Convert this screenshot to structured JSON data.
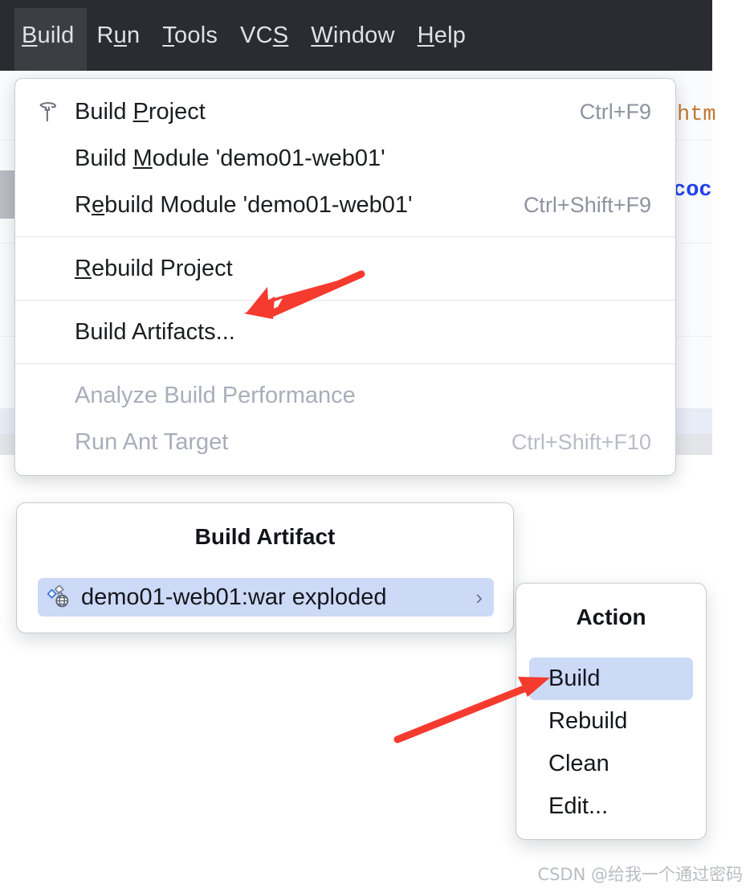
{
  "menubar": {
    "items": [
      {
        "label": "Build",
        "mnemonic": "B",
        "active": true
      },
      {
        "label": "Run",
        "mnemonic": "u",
        "active": false
      },
      {
        "label": "Tools",
        "mnemonic": "T",
        "active": false
      },
      {
        "label": "VCS",
        "mnemonic": "S",
        "active": false
      },
      {
        "label": "Window",
        "mnemonic": "W",
        "active": false
      },
      {
        "label": "Help",
        "mnemonic": "H",
        "active": false
      }
    ]
  },
  "build_menu": {
    "items": [
      {
        "label_pre": "Build ",
        "mnemonic": "P",
        "label_post": "roject",
        "accel": "Ctrl+F9",
        "icon": "hammer-icon",
        "disabled": false
      },
      {
        "label_pre": "Build ",
        "mnemonic": "M",
        "label_post": "odule 'demo01-web01'",
        "accel": "",
        "icon": "",
        "disabled": false
      },
      {
        "label_pre": "R",
        "mnemonic": "e",
        "label_post": "build Module 'demo01-web01'",
        "accel": "Ctrl+Shift+F9",
        "icon": "",
        "disabled": false
      },
      {
        "label_pre": "",
        "mnemonic": "R",
        "label_post": "ebuild Project",
        "accel": "",
        "icon": "",
        "disabled": false
      },
      {
        "label_pre": "Build Artifacts...",
        "mnemonic": "",
        "label_post": "",
        "accel": "",
        "icon": "",
        "disabled": false
      },
      {
        "label_pre": "Analyze Build Performance",
        "mnemonic": "",
        "label_post": "",
        "accel": "",
        "icon": "",
        "disabled": true
      },
      {
        "label_pre": "Run Ant Target",
        "mnemonic": "",
        "label_post": "",
        "accel": "Ctrl+Shift+F10",
        "icon": "",
        "disabled": true
      }
    ]
  },
  "artifact_popup": {
    "title": "Build Artifact",
    "item": {
      "label": "demo01-web01:war exploded",
      "icon": "artifact-icon",
      "chevron": "›",
      "selected": true
    }
  },
  "action_popup": {
    "title": "Action",
    "items": [
      {
        "label": "Build",
        "selected": true
      },
      {
        "label": "Rebuild",
        "selected": false
      },
      {
        "label": "Clean",
        "selected": false
      },
      {
        "label": "Edit...",
        "selected": false
      }
    ]
  },
  "editor": {
    "fragment_tag": "htm",
    "fragment_keyword": "coc"
  },
  "annotations": {
    "arrow_color": "#f53a2e",
    "arrow_1_target": "Build Artifacts...",
    "arrow_2_target": "Build"
  },
  "watermark": {
    "text": "CSDN @给我一个通过密码"
  }
}
